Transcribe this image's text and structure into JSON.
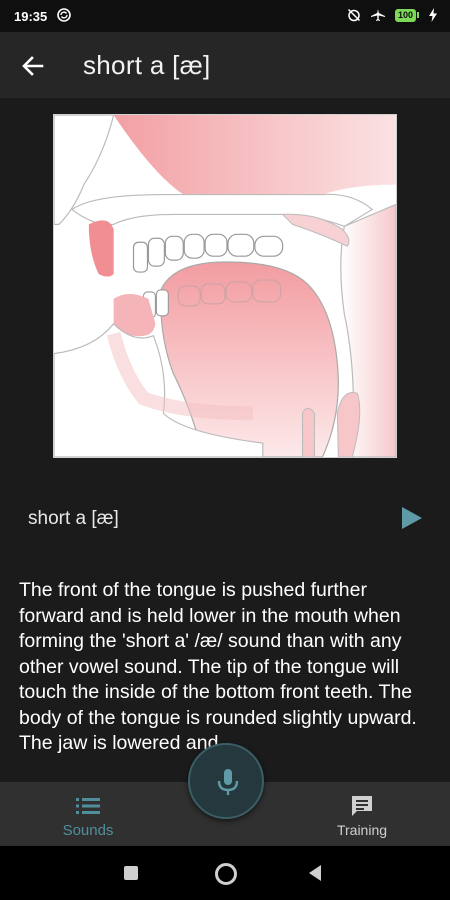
{
  "status_bar": {
    "time": "19:35",
    "battery_level": "100",
    "icons": [
      "sync-icon",
      "alarm-off-icon",
      "airplane-mode-icon",
      "battery-icon",
      "charging-icon"
    ]
  },
  "app_bar": {
    "title": "short a  [æ]"
  },
  "sound": {
    "label": "short a  [æ]",
    "description": "The front of the tongue is pushed further forward and is held lower in the mouth when forming the 'short a' /æ/ sound than with any other vowel sound. The tip of the tongue will touch the inside of the bottom front teeth. The body of the tongue is rounded slightly upward. The jaw is lowered and"
  },
  "bottom_nav": {
    "items": [
      {
        "label": "Sounds",
        "icon": "list-icon",
        "active": true
      },
      {
        "label": "Training",
        "icon": "feedback-icon",
        "active": false
      }
    ]
  },
  "colors": {
    "accent": "#4f8f9c",
    "background": "#1b1b1b",
    "app_bar": "#262626",
    "nav_bar": "#303030",
    "diagram_pink": "#f2a0a4"
  }
}
